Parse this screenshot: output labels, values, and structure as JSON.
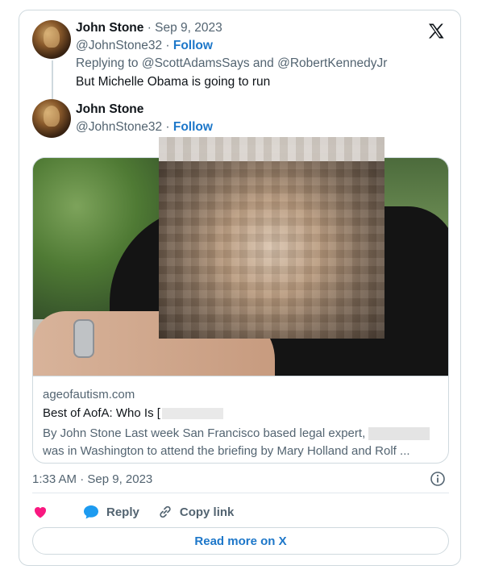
{
  "parent_tweet": {
    "author_name": "John Stone",
    "date_sep": " · ",
    "date": "Sep 9, 2023",
    "handle": "@JohnStone32",
    "handle_sep": " · ",
    "follow_label": "Follow",
    "replying_to": "Replying to @ScottAdamsSays and @RobertKennedyJr",
    "text": "But Michelle Obama is going to run"
  },
  "main_tweet": {
    "author_name": "John Stone",
    "handle": "@JohnStone32",
    "handle_sep": " · ",
    "follow_label": "Follow"
  },
  "link_card": {
    "domain": "ageofautism.com",
    "title": "Best of AofA: Who Is [",
    "desc_line1": "By John Stone Last week San Francisco based legal expert,",
    "desc_line2": "was in Washington to attend the briefing by Mary Holland and Rolf ..."
  },
  "timestamp": "1:33 AM · Sep 9, 2023",
  "actions": {
    "reply_label": "Reply",
    "copy_link_label": "Copy link"
  },
  "read_more_label": "Read more on X",
  "colors": {
    "link_blue": "#1d77c9",
    "heart_pink": "#f91880",
    "reply_blue": "#1d9bf0",
    "muted_text": "#536471"
  }
}
